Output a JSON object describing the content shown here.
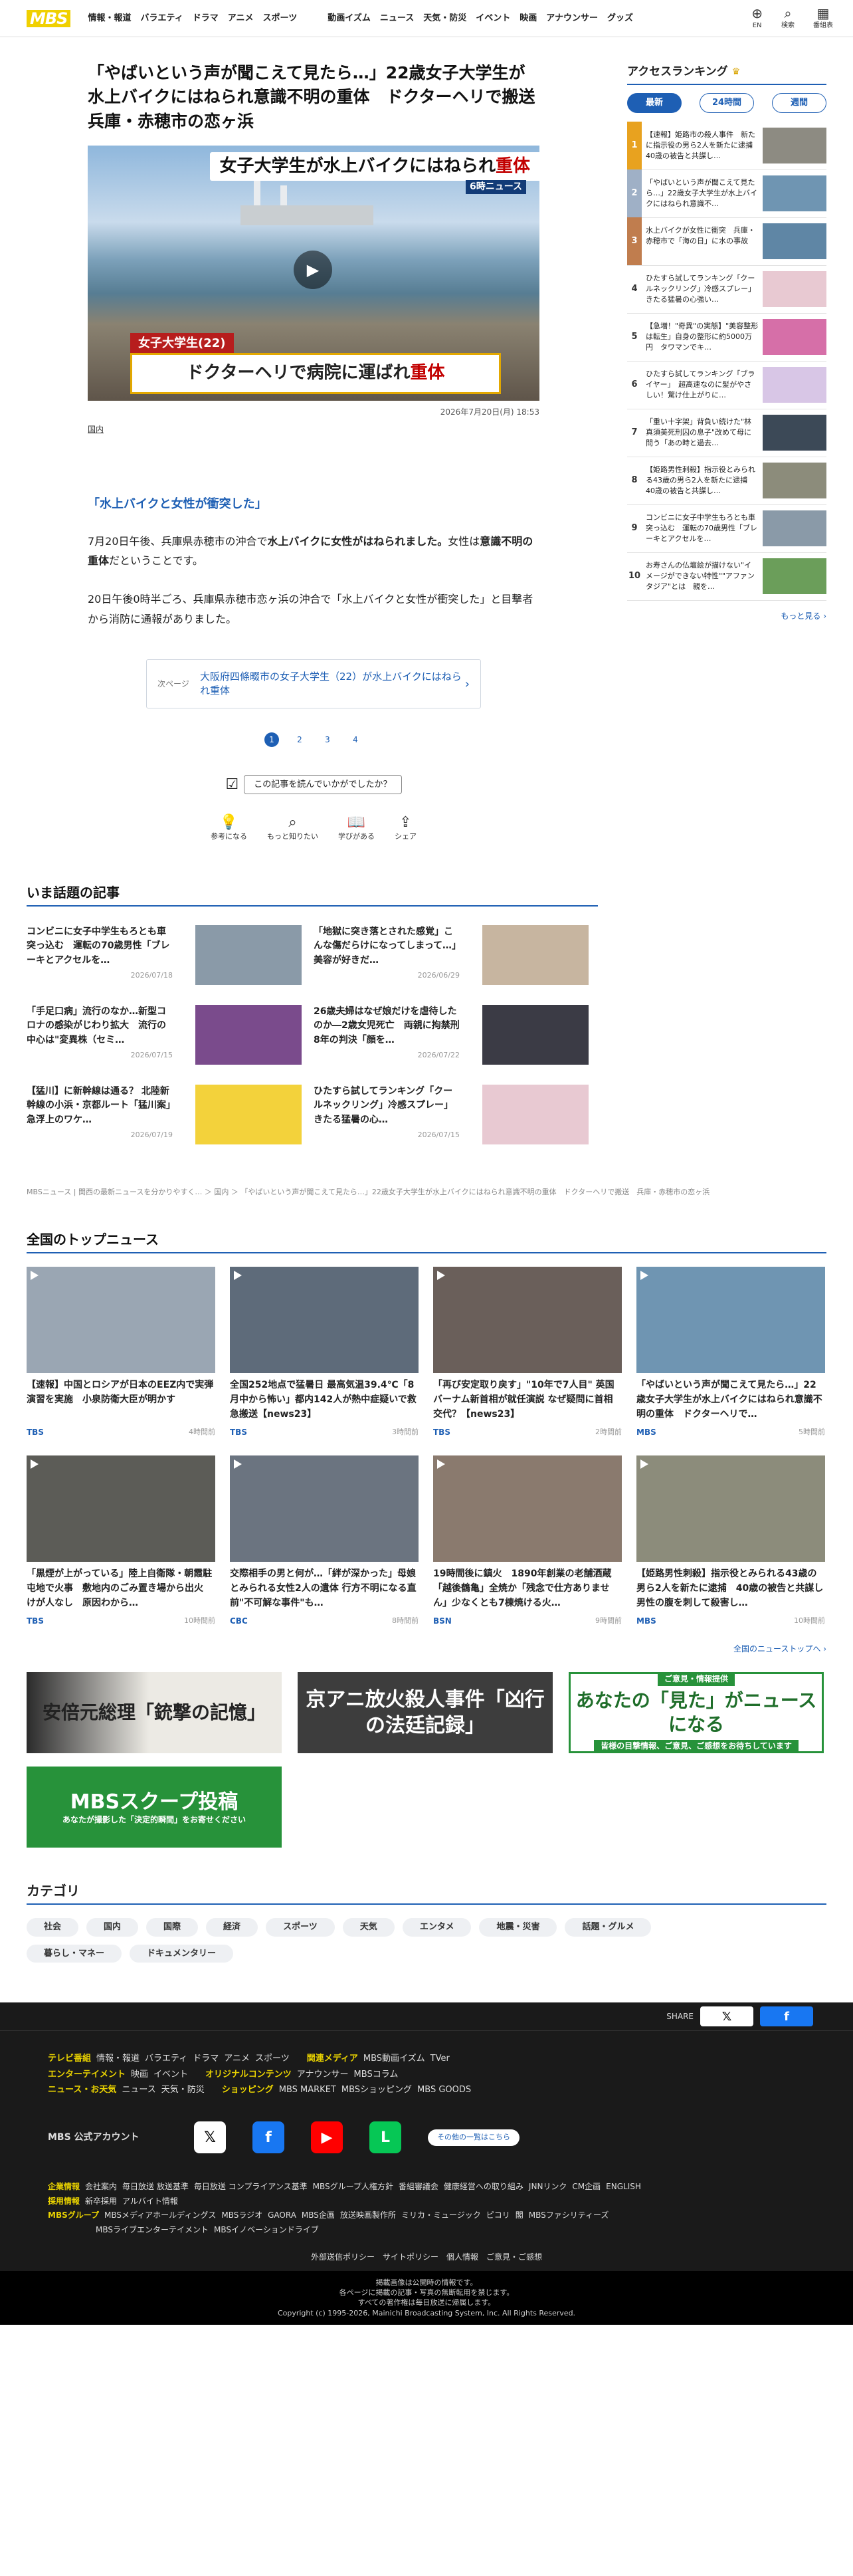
{
  "header": {
    "logo": "MBS",
    "nav": [
      "情報・報道",
      "バラエティ",
      "ドラマ",
      "アニメ",
      "スポーツ"
    ],
    "nav2": [
      "動画イズム",
      "ニュース",
      "天気・防災",
      "イベント",
      "映画",
      "アナウンサー",
      "グッズ"
    ],
    "icons": [
      {
        "icon": "globe-icon",
        "glyph": "⊕",
        "label": "EN"
      },
      {
        "icon": "search-icon",
        "glyph": "⌕",
        "label": "検索"
      },
      {
        "icon": "tv-guide-icon",
        "glyph": "▦",
        "label": "番組表"
      }
    ]
  },
  "article": {
    "title": "「やばいという声が聞こえて見たら…」22歳女子大学生が水上バイクにはねられ意識不明の重体　ドクターヘリで搬送　兵庫・赤穂市の恋ヶ浜",
    "video_banner_pre": "女子大学生が",
    "video_banner_mid": "水上バイクにはねられ",
    "video_banner_hl": "重体",
    "video_newsmark": "6時ニュース",
    "video_tag": "女子大学生(22)",
    "video_caption_pre": "ドクターヘリで病院に運ばれ",
    "video_caption_hl": "重体",
    "date": "2026年7月20日(月) 18:53",
    "category": "国内",
    "subhead": "「水上バイクと女性が衝突した」",
    "para1_a": "7月20日午後、兵庫県赤穂市の沖合で",
    "para1_b": "水上バイクに女性がはねられました。",
    "para1_c": "女性は",
    "para1_d": "意識不明の重体",
    "para1_e": "だということです。",
    "para2": "20日午後0時半ごろ、兵庫県赤穂市恋ヶ浜の沖合で「水上バイクと女性が衝突した」と目撃者から消防に通報がありました。",
    "next_label": "次ページ",
    "next_title": "大阪府四條畷市の女子大学生（22）が水上バイクにはねられ重体",
    "pages": [
      "1",
      "2",
      "3",
      "4"
    ],
    "survey": "この記事を読んでいかがでしたか？",
    "reactions": [
      {
        "icon": "lightbulb-icon",
        "glyph": "💡",
        "label": "参考になる"
      },
      {
        "icon": "search-icon",
        "glyph": "⌕",
        "label": "もっと知りたい"
      },
      {
        "icon": "book-icon",
        "glyph": "📖",
        "label": "学びがある"
      },
      {
        "icon": "share-icon",
        "glyph": "⇪",
        "label": "シェア"
      }
    ]
  },
  "trending": {
    "heading": "いま話題の記事",
    "items": [
      {
        "title": "コンビニに女子中学生もろとも車突っ込む　運転の70歳男性「ブレーキとアクセルを…",
        "date": "2026/07/18",
        "c": "#8a9aa8"
      },
      {
        "title": "「地獄に突き落とされた感覚」こんな傷だらけになってしまって…」美容が好きだ…",
        "date": "2026/06/29",
        "c": "#c7b5a0"
      },
      {
        "title": "「手足口病」流行のなか…新型コロナの感染がじわり拡大　流行の中心は\"変異株（セミ…",
        "date": "2026/07/15",
        "c": "#7a4b8c"
      },
      {
        "title": "26歳夫婦はなぜ娘だけを虐待したのか―2歳女児死亡　両親に拘禁刑8年の判決「顔を…",
        "date": "2026/07/22",
        "c": "#3b3b45"
      },
      {
        "title": "【猛川】に新幹線は通る？ 北陸新幹線の小浜・京都ルート「猛川案」急浮上のワケ…",
        "date": "2026/07/19",
        "c": "#f3d23b"
      },
      {
        "title": "ひたすら試してランキング「クールネックリング」冷感スプレー」きたる猛暑の心…",
        "date": "2026/07/15",
        "c": "#e8c9d2"
      }
    ]
  },
  "breadcrumb": "MBSニュース | 関西の最新ニュースを分かりやすく… ＞ 国内 ＞ 「やばいという声が聞こえて見たら…」22歳女子大学生が水上バイクにはねられ意識不明の重体　ドクターヘリで搬送　兵庫・赤穂市の恋ヶ浜",
  "topnews": {
    "heading": "全国のトップニュース",
    "items": [
      {
        "title": "【速報】中国とロシアが日本のEEZ内で実弾演習を実施　小泉防衛大臣が明かす",
        "src": "TBS",
        "time": "4時間前",
        "c": "#9aa6b3"
      },
      {
        "title": "全国252地点で猛暑日 最高気温39.4℃「8月中から怖い」都内142人が熱中症疑いで救急搬送【news23】",
        "src": "TBS",
        "time": "3時間前",
        "c": "#5e6b7a"
      },
      {
        "title": "「再び安定取り戻す」\"10年で7人目\" 英国バーナム新首相が就任演説 なぜ疑問に首相交代？【news23】",
        "src": "TBS",
        "time": "2時間前",
        "c": "#6a5f5a"
      },
      {
        "title": "「やばいという声が聞こえて見たら…」22歳女子大学生が水上バイクにはねられ意識不明の重体　ドクターヘリで…",
        "src": "MBS",
        "time": "5時間前",
        "c": "#6f95b2"
      },
      {
        "title": "「黒煙が上がっている」陸上自衛隊・朝霞駐屯地で火事　敷地内のごみ置き場から出火 けが人なし　原因わから…",
        "src": "TBS",
        "time": "10時間前",
        "c": "#5c5c57"
      },
      {
        "title": "交際相手の男と何が…「絆が深かった」母娘とみられる女性2人の遺体 行方不明になる直前\"不可解な事件\"も…",
        "src": "CBC",
        "time": "8時間前",
        "c": "#6b7480"
      },
      {
        "title": "19時間後に鎮火　1890年創業の老舗酒蔵「越後鶴亀」全焼か「残念で仕方ありません」少なくとも7棟焼ける火…",
        "src": "BSN",
        "time": "9時間前",
        "c": "#8a7a6e"
      },
      {
        "title": "【姫路男性刺殺】指示役とみられる43歳の男ら2人を新たに逮捕　40歳の被告と共謀し男性の腹を刺して殺害し…",
        "src": "MBS",
        "time": "10時間前",
        "c": "#8c8c7b"
      }
    ],
    "more": "全国のニューストップへ ›"
  },
  "banners": {
    "b1": "安倍元総理「銃撃の記憶」",
    "b2": "京アニ放火殺人事件「凶行の法廷記録」",
    "b3_top": "ご意見・情報提供",
    "b3_main": "あなたの「見た」がニュースになる",
    "b3_sub": "皆様の目撃情報、ご意見、ご感想をお待ちしています",
    "b4_main": "MBSスクープ投稿",
    "b4_sub": "あなたが撮影した「決定的瞬間」をお寄せください"
  },
  "categories": {
    "heading": "カテゴリ",
    "items": [
      "社会",
      "国内",
      "国際",
      "経済",
      "スポーツ",
      "天気",
      "エンタメ",
      "地震・災害",
      "話題・グルメ",
      "暮らし・マネー",
      "ドキュメンタリー"
    ]
  },
  "ranking": {
    "heading": "アクセスランキング",
    "tabs": [
      "最新",
      "24時間",
      "週間"
    ],
    "items": [
      {
        "title": "【速報】姫路市の殺人事件　新たに指示役の男ら2人を新たに逮捕　40歳の被告と共謀し…",
        "c": "#8d8b82"
      },
      {
        "title": "「やばいという声が聞こえて見たら…」22歳女子大学生が水上バイクにはねられ意識不…",
        "c": "#6f95b2"
      },
      {
        "title": "水上バイクが女性に衝突　兵庫・赤穂市で「海の日」に水の事故",
        "c": "#5f86a5"
      },
      {
        "title": "ひたすら試してランキング「クールネックリング」冷感スプレー」きたる猛暑の心強い…",
        "c": "#e8c9d2"
      },
      {
        "title": "【急増！\"奇異\"の実態】\"美容整形は転生」自身の整形に約5000万円　タワマンでキ…",
        "c": "#d66fa8"
      },
      {
        "title": "ひたすら試してランキング「ブライヤー」　超高速なのに髪がやさしい！驚け仕上がりに…",
        "c": "#d8c6e6"
      },
      {
        "title": "「重い十字架」背負い続けた\"林真須美死刑囚の息子\"改めて母に問う「あの時と過去…",
        "c": "#3c4957"
      },
      {
        "title": "【姫路男性刺殺】指示役とみられる43歳の男ら2人を新たに逮捕　40歳の被告と共謀し…",
        "c": "#8c8c7b"
      },
      {
        "title": "コンビニに女子中学生もろとも車突っ込む　運転の70歳男性「ブレーキとアクセルを…",
        "c": "#8a9aa8"
      },
      {
        "title": "お寿さんの仏壇絵が描けない\"イメージができない特性\"\"アファンタジア\"とは　親を…",
        "c": "#6b9e5a"
      }
    ],
    "more": "もっと見る ›"
  },
  "footer": {
    "share": "SHARE",
    "rows": [
      {
        "k": "テレビ番組",
        "v": [
          "情報・報道",
          "バラエティ",
          "ドラマ",
          "アニメ",
          "スポーツ"
        ],
        "k2": "関連メディア",
        "v2": [
          "MBS動画イズム",
          "TVer"
        ]
      },
      {
        "k": "エンターテイメント",
        "v": [
          "映画",
          "イベント"
        ],
        "k2": "オリジナルコンテンツ",
        "v2": [
          "アナウンサー",
          "MBSコラム"
        ]
      },
      {
        "k": "ニュース・お天気",
        "v": [
          "ニュース",
          "天気・防災"
        ],
        "k2": "ショッピング",
        "v2": [
          "MBS MARKET",
          "MBSショッピング",
          "MBS GOODS"
        ]
      }
    ],
    "account_label": "MBS 公式アカウント",
    "other_accounts": "その他の一覧はこちら",
    "corp": {
      "k": "企業情報",
      "v": [
        "会社案内",
        "毎日放送 放送基準",
        "毎日放送 コンプライアンス基準",
        "MBSグループ人権方針",
        "番組審議会",
        "健康経営への取り組み",
        "JNNリンク",
        "CM企画",
        "ENGLISH"
      ]
    },
    "recruit": {
      "k": "採用情報",
      "v": [
        "新卒採用",
        "アルバイト情報"
      ]
    },
    "group": {
      "k": "MBSグループ",
      "v": [
        "MBSメディアホールディングス",
        "MBSラジオ",
        "GAORA",
        "MBS企画",
        "放送映画製作所",
        "ミリカ・ミュージック",
        "ピコリ",
        "閣",
        "MBSファシリティーズ"
      ]
    },
    "group2": [
      "MBSライブエンターテイメント",
      "MBSイノベーションドライブ"
    ],
    "bottom": [
      "外部送信ポリシー",
      "サイトポリシー",
      "個人情報",
      "ご意見・ご感想"
    ],
    "copy1": "掲載画像は公開時の情報です。",
    "copy2": "各ページに掲載の記事・写真の無断転用を禁じます。",
    "copy3": "すべての著作権は毎日放送に帰属します。",
    "copy4": "Copyright (c) 1995-2026, Mainichi Broadcasting System, Inc. All Rights Reserved."
  }
}
